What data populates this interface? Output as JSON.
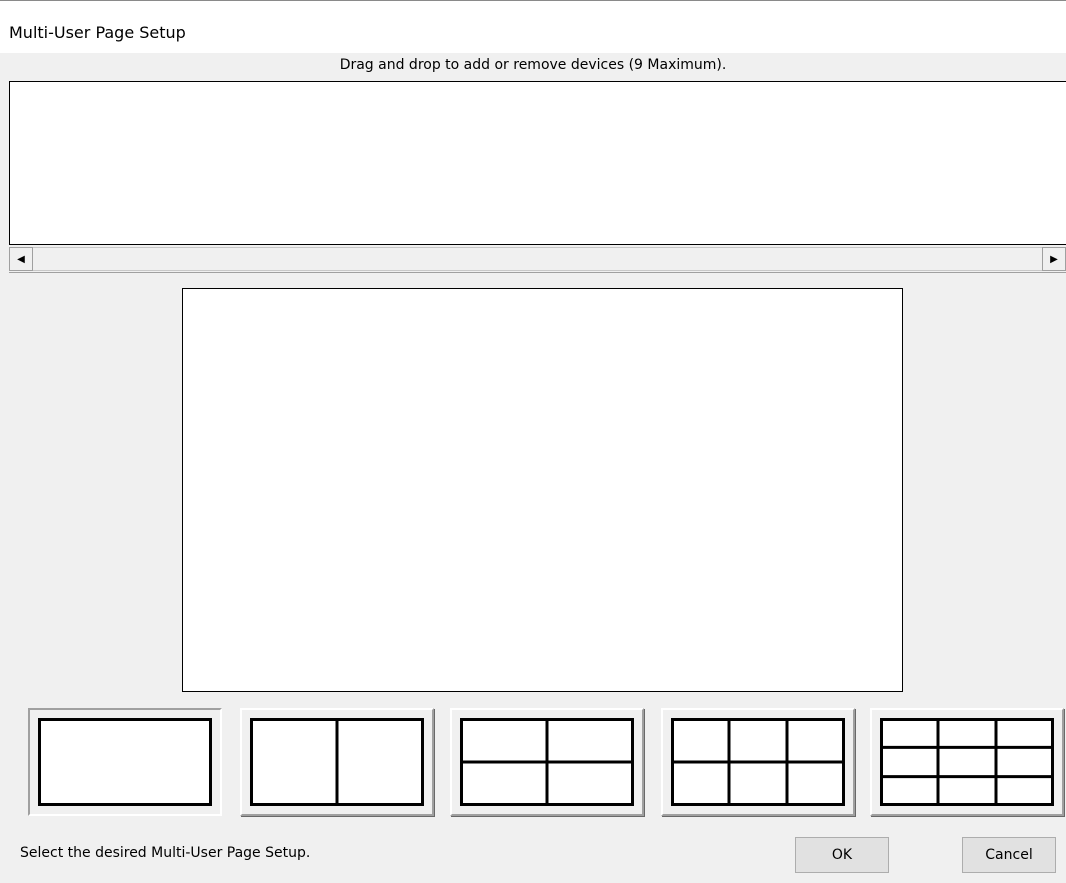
{
  "window": {
    "title": "Multi-User Page Setup"
  },
  "instruction_text": "Drag and drop to add or remove devices (9 Maximum).",
  "scrollbar": {
    "left_arrow": "◀",
    "right_arrow": "▶"
  },
  "layouts": [
    {
      "id": "1x1",
      "cols": 1,
      "rows": 1,
      "selected": true
    },
    {
      "id": "1x2",
      "cols": 2,
      "rows": 1,
      "selected": false
    },
    {
      "id": "2x2",
      "cols": 2,
      "rows": 2,
      "selected": false
    },
    {
      "id": "2x3",
      "cols": 3,
      "rows": 2,
      "selected": false
    },
    {
      "id": "3x3",
      "cols": 3,
      "rows": 3,
      "selected": false
    }
  ],
  "status_text": "Select the desired Multi-User Page Setup.",
  "buttons": {
    "ok": "OK",
    "cancel": "Cancel"
  }
}
